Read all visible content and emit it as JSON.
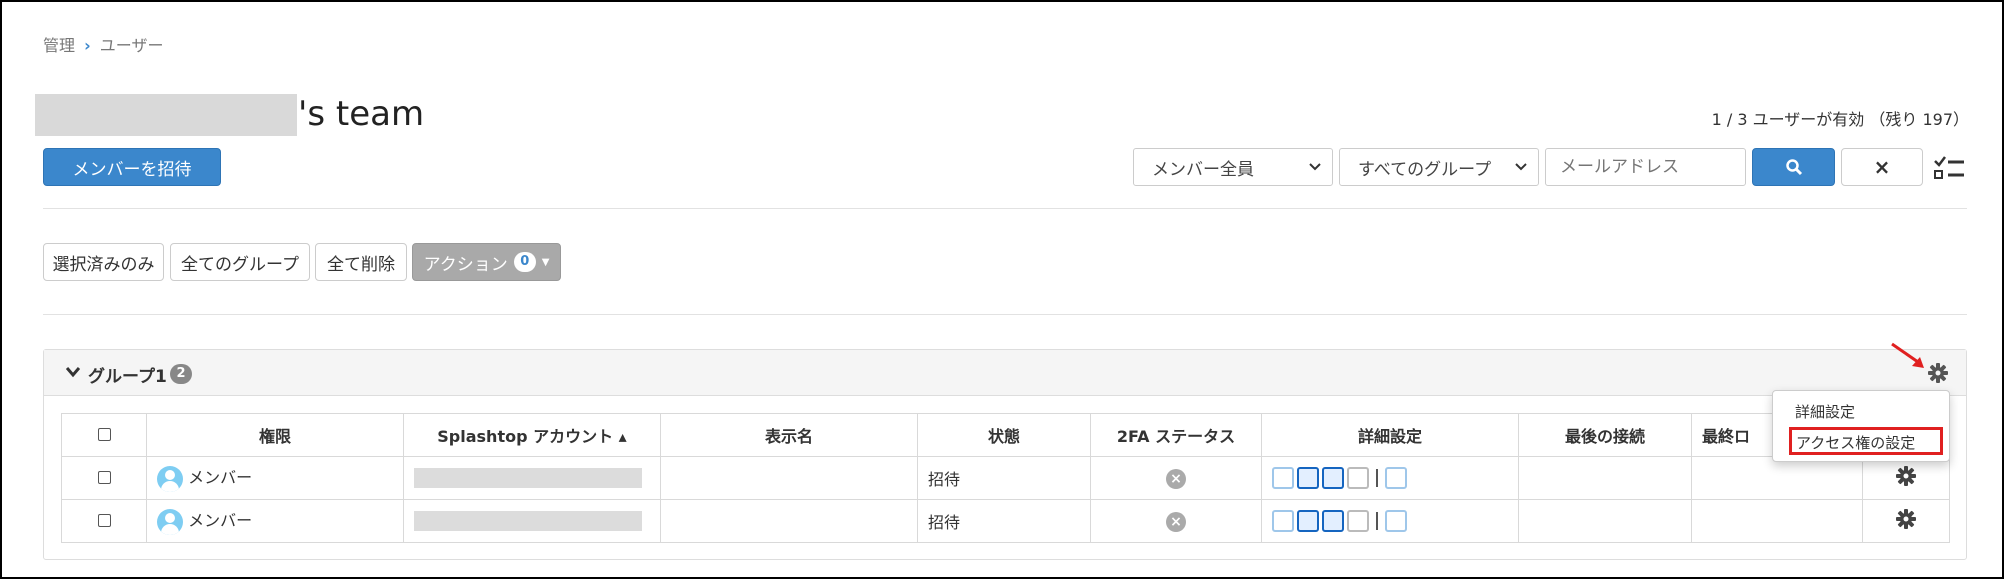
{
  "breadcrumb": {
    "root": "管理",
    "current": "ユーザー"
  },
  "team": {
    "name_suffix": "'s team"
  },
  "user_count": "1 / 3 ユーザーが有効 （残り 197）",
  "toolbar": {
    "invite_label": "メンバーを招待",
    "filter_members": "メンバー全員",
    "filter_groups": "すべてのグループ",
    "email_placeholder": "メールアドレス",
    "clear_label": "×"
  },
  "group_filter": {
    "selected_only": "選択済みのみ",
    "all_groups": "全てのグループ",
    "clear_all": "全て削除",
    "actions_label": "アクション",
    "actions_count": "0"
  },
  "group": {
    "name": "グループ1",
    "count": "2",
    "columns": [
      "権限",
      "Splashtop アカウント ▴",
      "表示名",
      "状態",
      "2FA ステータス",
      "詳細設定",
      "最後の接続",
      "最終ロ"
    ],
    "rows": [
      {
        "role": "メンバー",
        "status": "招待"
      },
      {
        "role": "メンバー",
        "status": "招待"
      }
    ]
  },
  "dropdown": {
    "item1": "詳細設定",
    "item2": "アクセス権の設定"
  },
  "colors": {
    "primary": "#3b87cc",
    "highlight": "#e02020",
    "actions_bg": "#a9a9a9"
  }
}
